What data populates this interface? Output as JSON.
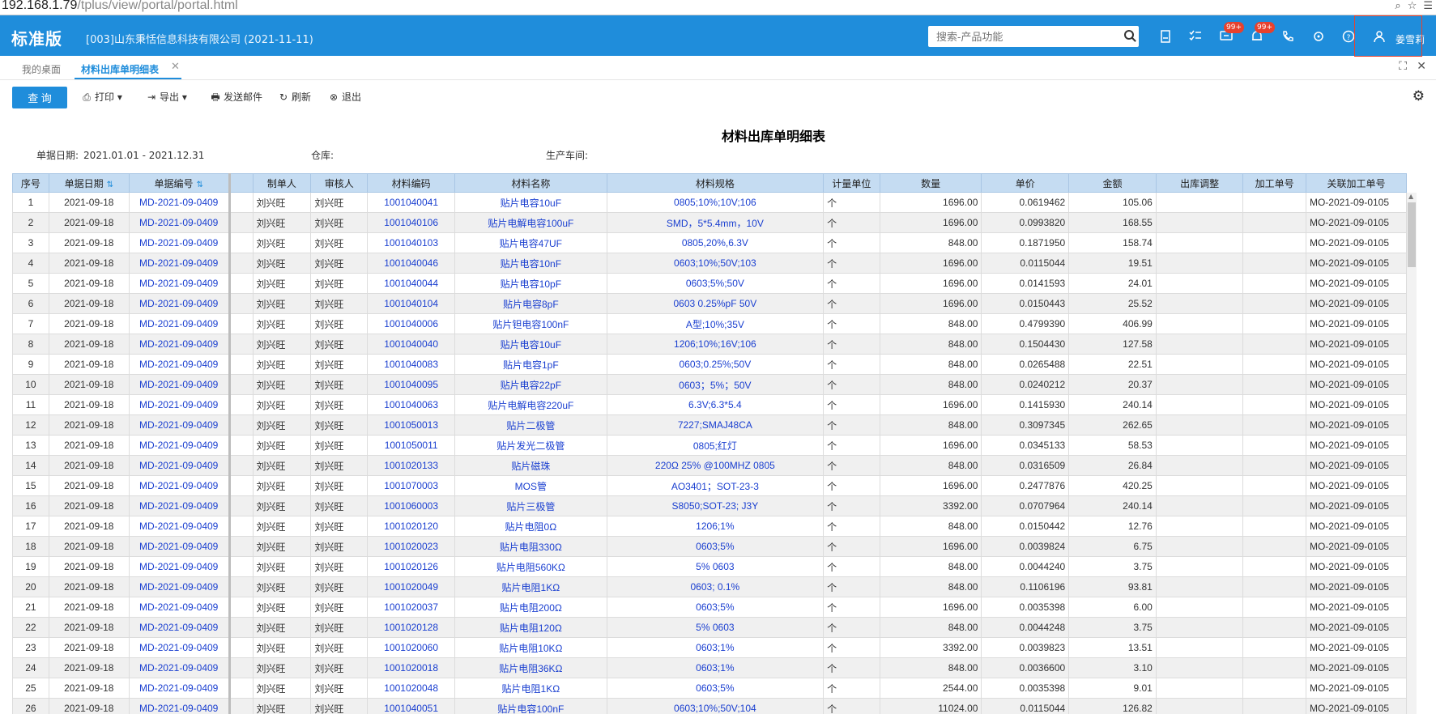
{
  "browser": {
    "url_host": "192.168.1.79",
    "url_path": "/tplus/view/portal/portal.html"
  },
  "header": {
    "brand": "标准版",
    "company": "[003]山东秉恬信息科技有限公司   (2021-11-11)",
    "search_placeholder": "搜索-产品功能",
    "badge1": "99+",
    "badge2": "99+",
    "username": "姜雪莉"
  },
  "tabs": {
    "home": "我的桌面",
    "active": "材料出库单明细表",
    "close": "✕"
  },
  "toolbar": {
    "query": "查 询",
    "print": "打印",
    "export": "导出",
    "email": "发送邮件",
    "refresh": "刷新",
    "exit": "退出"
  },
  "report": {
    "title": "材料出库单明细表",
    "date_label": "单据日期:",
    "date_value": "2021.01.01 - 2021.12.31",
    "warehouse_label": "仓库:",
    "workshop_label": "生产车间:"
  },
  "columns": [
    "序号",
    "单据日期",
    "单据编号",
    "制单人",
    "审核人",
    "材料编码",
    "材料名称",
    "材料规格",
    "计量单位",
    "数量",
    "单价",
    "金额",
    "出库调整",
    "加工单号",
    "关联加工单号"
  ],
  "rows": [
    [
      "1",
      "2021-09-18",
      "MD-2021-09-0409",
      "刘兴旺",
      "刘兴旺",
      "1001040041",
      "贴片电容10uF",
      "0805;10%;10V;106",
      "个",
      "1696.00",
      "0.0619462",
      "105.06",
      "",
      "",
      "MO-2021-09-0105"
    ],
    [
      "2",
      "2021-09-18",
      "MD-2021-09-0409",
      "刘兴旺",
      "刘兴旺",
      "1001040106",
      "贴片电解电容100uF",
      "SMD，5*5.4mm，10V",
      "个",
      "1696.00",
      "0.0993820",
      "168.55",
      "",
      "",
      "MO-2021-09-0105"
    ],
    [
      "3",
      "2021-09-18",
      "MD-2021-09-0409",
      "刘兴旺",
      "刘兴旺",
      "1001040103",
      "贴片电容47UF",
      "0805,20%,6.3V",
      "个",
      "848.00",
      "0.1871950",
      "158.74",
      "",
      "",
      "MO-2021-09-0105"
    ],
    [
      "4",
      "2021-09-18",
      "MD-2021-09-0409",
      "刘兴旺",
      "刘兴旺",
      "1001040046",
      "贴片电容10nF",
      "0603;10%;50V;103",
      "个",
      "1696.00",
      "0.0115044",
      "19.51",
      "",
      "",
      "MO-2021-09-0105"
    ],
    [
      "5",
      "2021-09-18",
      "MD-2021-09-0409",
      "刘兴旺",
      "刘兴旺",
      "1001040044",
      "贴片电容10pF",
      "0603;5%;50V",
      "个",
      "1696.00",
      "0.0141593",
      "24.01",
      "",
      "",
      "MO-2021-09-0105"
    ],
    [
      "6",
      "2021-09-18",
      "MD-2021-09-0409",
      "刘兴旺",
      "刘兴旺",
      "1001040104",
      "贴片电容8pF",
      "0603 0.25%pF 50V",
      "个",
      "1696.00",
      "0.0150443",
      "25.52",
      "",
      "",
      "MO-2021-09-0105"
    ],
    [
      "7",
      "2021-09-18",
      "MD-2021-09-0409",
      "刘兴旺",
      "刘兴旺",
      "1001040006",
      "贴片钽电容100nF",
      "A型;10%;35V",
      "个",
      "848.00",
      "0.4799390",
      "406.99",
      "",
      "",
      "MO-2021-09-0105"
    ],
    [
      "8",
      "2021-09-18",
      "MD-2021-09-0409",
      "刘兴旺",
      "刘兴旺",
      "1001040040",
      "贴片电容10uF",
      "1206;10%;16V;106",
      "个",
      "848.00",
      "0.1504430",
      "127.58",
      "",
      "",
      "MO-2021-09-0105"
    ],
    [
      "9",
      "2021-09-18",
      "MD-2021-09-0409",
      "刘兴旺",
      "刘兴旺",
      "1001040083",
      "贴片电容1pF",
      "0603;0.25%;50V",
      "个",
      "848.00",
      "0.0265488",
      "22.51",
      "",
      "",
      "MO-2021-09-0105"
    ],
    [
      "10",
      "2021-09-18",
      "MD-2021-09-0409",
      "刘兴旺",
      "刘兴旺",
      "1001040095",
      "贴片电容22pF",
      "0603；5%；50V",
      "个",
      "848.00",
      "0.0240212",
      "20.37",
      "",
      "",
      "MO-2021-09-0105"
    ],
    [
      "11",
      "2021-09-18",
      "MD-2021-09-0409",
      "刘兴旺",
      "刘兴旺",
      "1001040063",
      "贴片电解电容220uF",
      "6.3V;6.3*5.4",
      "个",
      "1696.00",
      "0.1415930",
      "240.14",
      "",
      "",
      "MO-2021-09-0105"
    ],
    [
      "12",
      "2021-09-18",
      "MD-2021-09-0409",
      "刘兴旺",
      "刘兴旺",
      "1001050013",
      "贴片二极管",
      "7227;SMAJ48CA",
      "个",
      "848.00",
      "0.3097345",
      "262.65",
      "",
      "",
      "MO-2021-09-0105"
    ],
    [
      "13",
      "2021-09-18",
      "MD-2021-09-0409",
      "刘兴旺",
      "刘兴旺",
      "1001050011",
      "贴片发光二极管",
      "0805;红灯",
      "个",
      "1696.00",
      "0.0345133",
      "58.53",
      "",
      "",
      "MO-2021-09-0105"
    ],
    [
      "14",
      "2021-09-18",
      "MD-2021-09-0409",
      "刘兴旺",
      "刘兴旺",
      "1001020133",
      "贴片磁珠",
      "220Ω 25% @100MHZ 0805",
      "个",
      "848.00",
      "0.0316509",
      "26.84",
      "",
      "",
      "MO-2021-09-0105"
    ],
    [
      "15",
      "2021-09-18",
      "MD-2021-09-0409",
      "刘兴旺",
      "刘兴旺",
      "1001070003",
      "MOS管",
      "AO3401；SOT-23-3",
      "个",
      "1696.00",
      "0.2477876",
      "420.25",
      "",
      "",
      "MO-2021-09-0105"
    ],
    [
      "16",
      "2021-09-18",
      "MD-2021-09-0409",
      "刘兴旺",
      "刘兴旺",
      "1001060003",
      "贴片三极管",
      "S8050;SOT-23; J3Y",
      "个",
      "3392.00",
      "0.0707964",
      "240.14",
      "",
      "",
      "MO-2021-09-0105"
    ],
    [
      "17",
      "2021-09-18",
      "MD-2021-09-0409",
      "刘兴旺",
      "刘兴旺",
      "1001020120",
      "贴片电阻0Ω",
      "1206;1%",
      "个",
      "848.00",
      "0.0150442",
      "12.76",
      "",
      "",
      "MO-2021-09-0105"
    ],
    [
      "18",
      "2021-09-18",
      "MD-2021-09-0409",
      "刘兴旺",
      "刘兴旺",
      "1001020023",
      "贴片电阻330Ω",
      "0603;5%",
      "个",
      "1696.00",
      "0.0039824",
      "6.75",
      "",
      "",
      "MO-2021-09-0105"
    ],
    [
      "19",
      "2021-09-18",
      "MD-2021-09-0409",
      "刘兴旺",
      "刘兴旺",
      "1001020126",
      "贴片电阻560KΩ",
      "5% 0603",
      "个",
      "848.00",
      "0.0044240",
      "3.75",
      "",
      "",
      "MO-2021-09-0105"
    ],
    [
      "20",
      "2021-09-18",
      "MD-2021-09-0409",
      "刘兴旺",
      "刘兴旺",
      "1001020049",
      "贴片电阻1KΩ",
      "0603; 0.1%",
      "个",
      "848.00",
      "0.1106196",
      "93.81",
      "",
      "",
      "MO-2021-09-0105"
    ],
    [
      "21",
      "2021-09-18",
      "MD-2021-09-0409",
      "刘兴旺",
      "刘兴旺",
      "1001020037",
      "贴片电阻200Ω",
      "0603;5%",
      "个",
      "1696.00",
      "0.0035398",
      "6.00",
      "",
      "",
      "MO-2021-09-0105"
    ],
    [
      "22",
      "2021-09-18",
      "MD-2021-09-0409",
      "刘兴旺",
      "刘兴旺",
      "1001020128",
      "贴片电阻120Ω",
      "5% 0603",
      "个",
      "848.00",
      "0.0044248",
      "3.75",
      "",
      "",
      "MO-2021-09-0105"
    ],
    [
      "23",
      "2021-09-18",
      "MD-2021-09-0409",
      "刘兴旺",
      "刘兴旺",
      "1001020060",
      "贴片电阻10KΩ",
      "0603;1%",
      "个",
      "3392.00",
      "0.0039823",
      "13.51",
      "",
      "",
      "MO-2021-09-0105"
    ],
    [
      "24",
      "2021-09-18",
      "MD-2021-09-0409",
      "刘兴旺",
      "刘兴旺",
      "1001020018",
      "贴片电阻36KΩ",
      "0603;1%",
      "个",
      "848.00",
      "0.0036600",
      "3.10",
      "",
      "",
      "MO-2021-09-0105"
    ],
    [
      "25",
      "2021-09-18",
      "MD-2021-09-0409",
      "刘兴旺",
      "刘兴旺",
      "1001020048",
      "贴片电阻1KΩ",
      "0603;5%",
      "个",
      "2544.00",
      "0.0035398",
      "9.01",
      "",
      "",
      "MO-2021-09-0105"
    ],
    [
      "26",
      "2021-09-18",
      "MD-2021-09-0409",
      "刘兴旺",
      "刘兴旺",
      "1001040051",
      "贴片电容100nF",
      "0603;10%;50V;104",
      "个",
      "11024.00",
      "0.0115044",
      "126.82",
      "",
      "",
      "MO-2021-09-0105"
    ]
  ]
}
